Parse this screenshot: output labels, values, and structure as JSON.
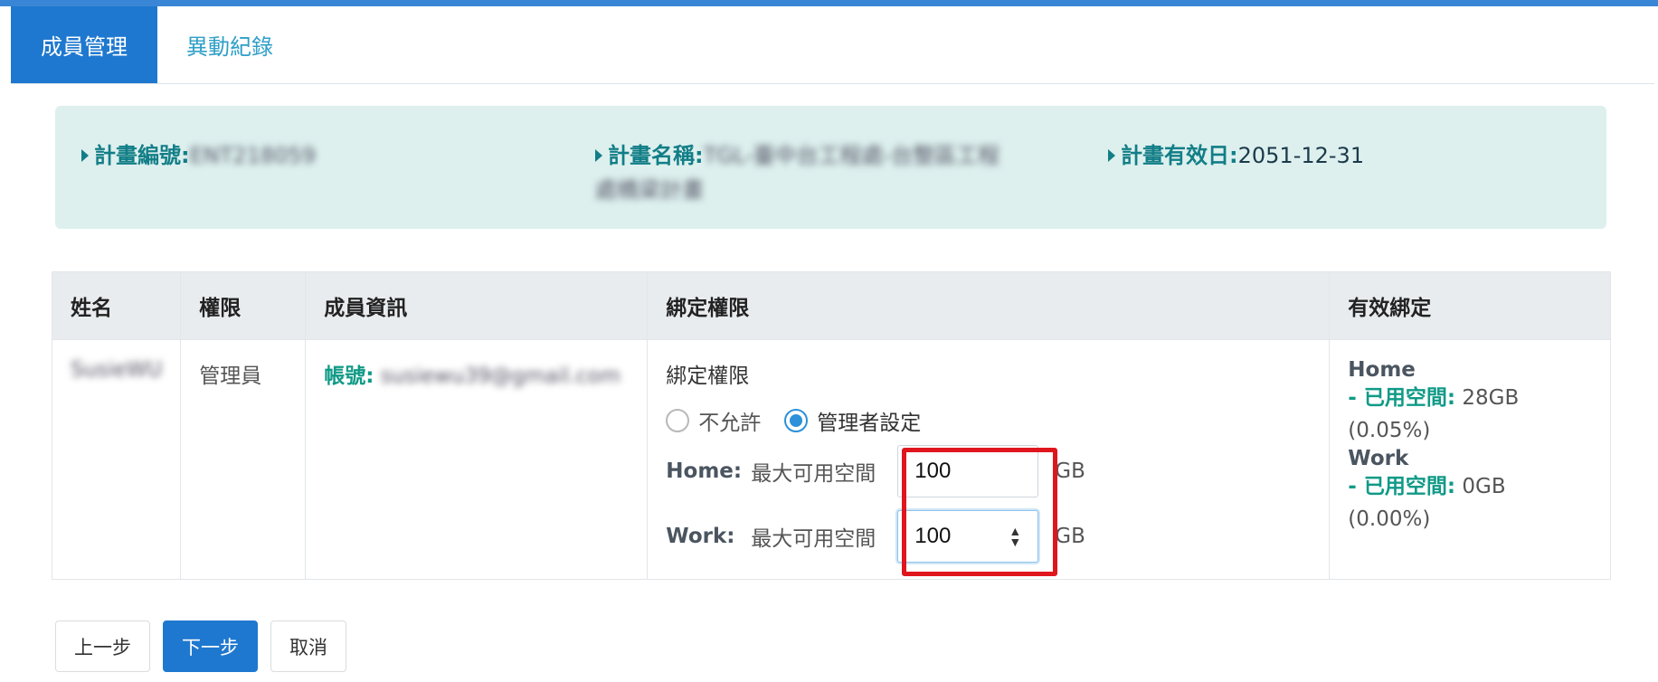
{
  "tabs": [
    {
      "label": "成員管理",
      "active": true
    },
    {
      "label": "異動紀錄",
      "active": false
    }
  ],
  "plan": {
    "number_label": "計畫編號:",
    "number_value": "ENT218059",
    "name_label": "計畫名稱:",
    "name_value": "TGL-臺中台工程處-台整區工程處橋梁計畫",
    "valid_label": "計畫有效日:",
    "valid_value": "2051-12-31"
  },
  "table": {
    "headers": [
      "姓名",
      "權限",
      "成員資訊",
      "綁定權限",
      "有效綁定"
    ],
    "row": {
      "name": "SusieWU",
      "role": "管理員",
      "account_label": "帳號:",
      "account_value": "susiewu39@gmail.com",
      "binding_title": "綁定權限",
      "radio_options": [
        {
          "label": "不允許",
          "checked": false
        },
        {
          "label": "管理者設定",
          "checked": true
        }
      ],
      "quotas": [
        {
          "name": "Home:",
          "label": "最大可用空間",
          "value": "100",
          "unit": "GB"
        },
        {
          "name": "Work:",
          "label": "最大可用空間",
          "value": "100",
          "unit": "GB"
        }
      ],
      "effective": [
        {
          "name": "Home",
          "used_label": "- 已用空間:",
          "used_value": "28GB",
          "percent": "(0.05%)"
        },
        {
          "name": "Work",
          "used_label": "- 已用空間:",
          "used_value": "0GB",
          "percent": "(0.00%)"
        }
      ]
    }
  },
  "buttons": {
    "prev": "上一步",
    "next": "下一步",
    "cancel": "取消"
  },
  "colors": {
    "primary": "#1f78cf",
    "teal": "#109a87",
    "info_bg": "#ddf0ee",
    "highlight": "#e0161e"
  }
}
